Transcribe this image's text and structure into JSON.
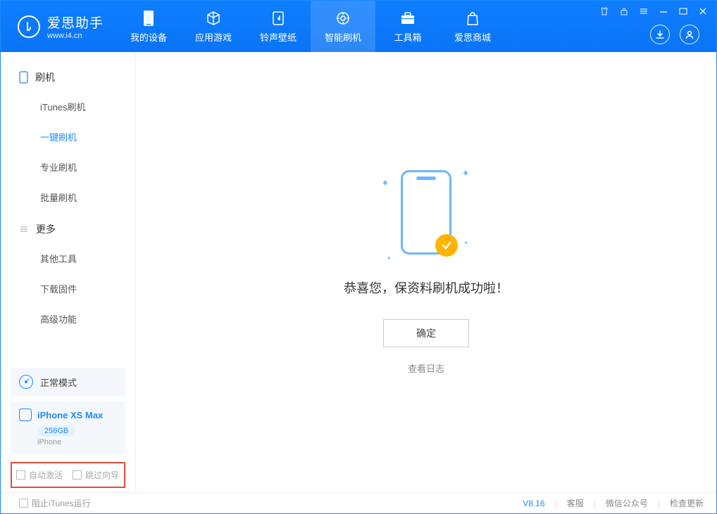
{
  "app": {
    "title": "爱思助手",
    "subtitle": "www.i4.cn"
  },
  "nav": [
    {
      "label": "我的设备"
    },
    {
      "label": "应用游戏"
    },
    {
      "label": "铃声壁纸"
    },
    {
      "label": "智能刷机"
    },
    {
      "label": "工具箱"
    },
    {
      "label": "爱思商城"
    }
  ],
  "sidebar": {
    "section1": {
      "title": "刷机"
    },
    "items1": [
      {
        "label": "iTunes刷机"
      },
      {
        "label": "一键刷机"
      },
      {
        "label": "专业刷机"
      },
      {
        "label": "批量刷机"
      }
    ],
    "section2": {
      "title": "更多"
    },
    "items2": [
      {
        "label": "其他工具"
      },
      {
        "label": "下载固件"
      },
      {
        "label": "高级功能"
      }
    ],
    "mode": "正常模式",
    "device": {
      "name": "iPhone XS Max",
      "storage": "256GB",
      "type": "iPhone"
    },
    "options": {
      "auto_activate": "自动激活",
      "skip_guide": "跳过向导"
    }
  },
  "main": {
    "success_message": "恭喜您，保资料刷机成功啦！",
    "ok_button": "确定",
    "view_log": "查看日志"
  },
  "footer": {
    "block_itunes": "阻止iTunes运行",
    "version": "V8.16",
    "support": "客服",
    "wechat": "微信公众号",
    "check_update": "检查更新"
  }
}
